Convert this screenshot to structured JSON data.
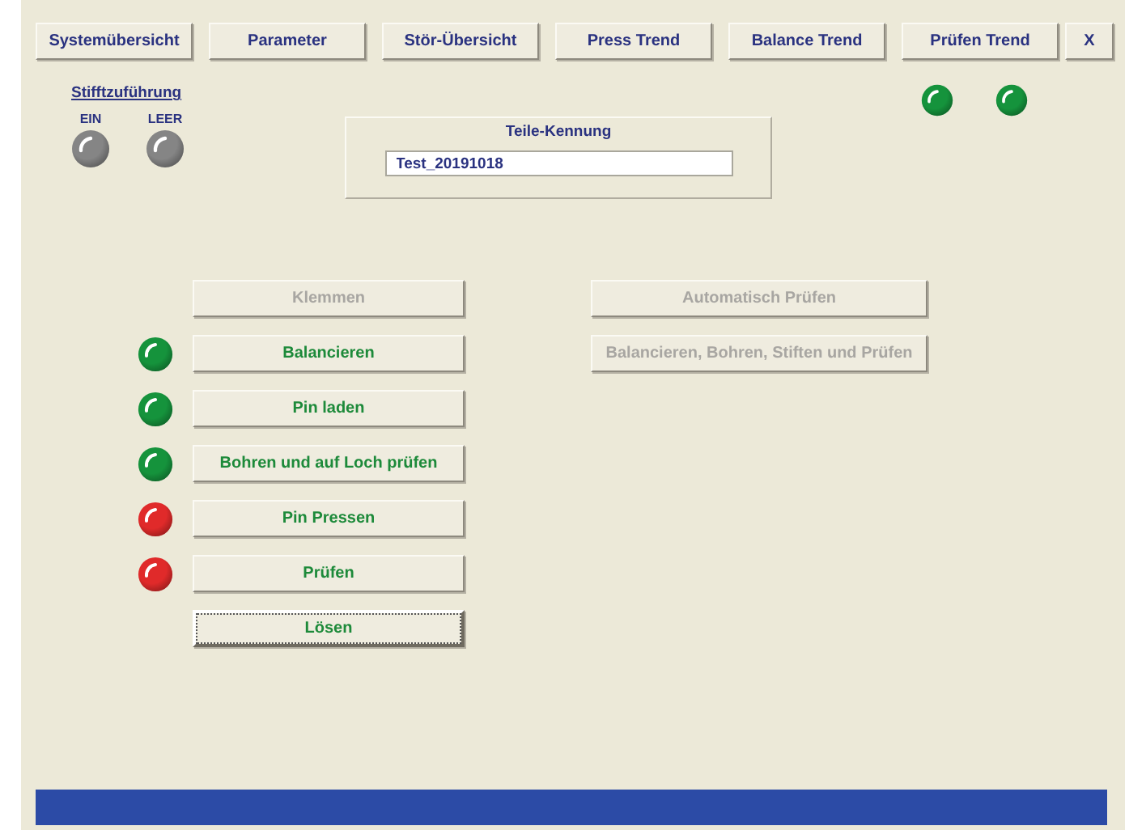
{
  "nav_buttons": [
    {
      "label": "Systemübersicht"
    },
    {
      "label": "Parameter"
    },
    {
      "label": "Stör-Übersicht"
    },
    {
      "label": "Press Trend"
    },
    {
      "label": "Balance Trend"
    },
    {
      "label": "Prüfen Trend"
    },
    {
      "label": "X"
    }
  ],
  "status_lamps": [
    {
      "color": "#15933c"
    },
    {
      "color": "#15933c"
    }
  ],
  "pin_feed": {
    "title": "Stifftzuführung",
    "lamps": [
      {
        "label": "EIN",
        "color": "#858585"
      },
      {
        "label": "LEER",
        "color": "#858585"
      }
    ]
  },
  "part_id": {
    "title": "Teile-Kennung",
    "value": "Test_20191018"
  },
  "steps": [
    {
      "label": "Klemmen",
      "disabled": true,
      "focused": false
    },
    {
      "label": "Balancieren",
      "disabled": false,
      "focused": false,
      "color": "#15933c"
    },
    {
      "label": "Pin laden",
      "disabled": false,
      "focused": false,
      "color": "#15933c"
    },
    {
      "label": "Bohren und auf Loch prüfen",
      "disabled": false,
      "focused": false,
      "color": "#15933c"
    },
    {
      "label": "Pin Pressen",
      "disabled": false,
      "focused": false,
      "color": "#e02a2a"
    },
    {
      "label": "Prüfen",
      "disabled": false,
      "focused": false,
      "color": "#e02a2a"
    },
    {
      "label": "Lösen",
      "disabled": false,
      "focused": true
    }
  ],
  "auto_buttons": [
    {
      "label": "Automatisch Prüfen",
      "disabled": true
    },
    {
      "label": "Balancieren, Bohren, Stiften und Prüfen",
      "disabled": true
    }
  ]
}
